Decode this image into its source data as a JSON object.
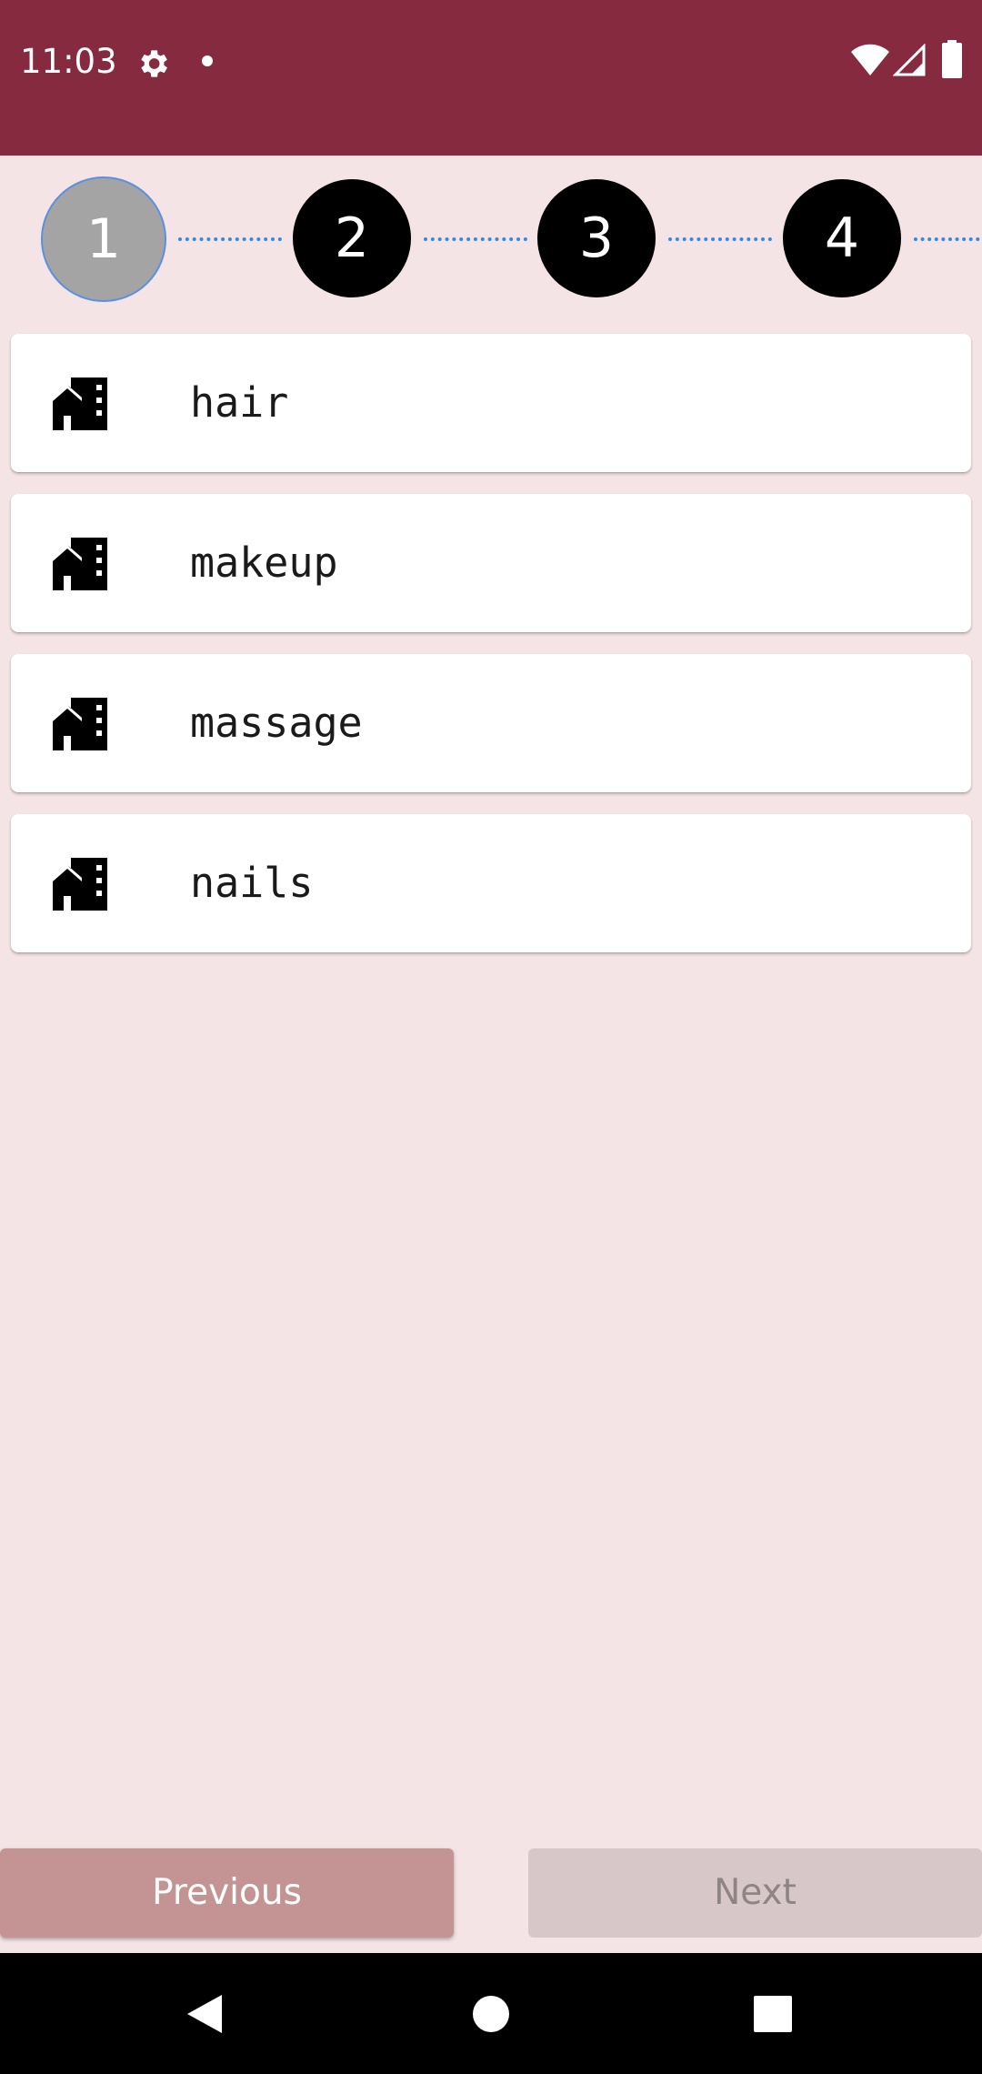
{
  "status_bar": {
    "time": "11:03",
    "bg_color": "#862a40",
    "icons": [
      "gear-icon",
      "dot-icon",
      "wifi-icon",
      "signal-icon",
      "battery-icon"
    ]
  },
  "stepper": {
    "active_step": 1,
    "steps": [
      {
        "label": "1",
        "state": "active"
      },
      {
        "label": "2",
        "state": "inactive"
      },
      {
        "label": "3",
        "state": "inactive"
      },
      {
        "label": "4",
        "state": "inactive"
      }
    ],
    "connector_color": "#2f8be6"
  },
  "services": [
    {
      "label": "hair",
      "icon": "store-building-icon"
    },
    {
      "label": "makeup",
      "icon": "store-building-icon"
    },
    {
      "label": "massage",
      "icon": "store-building-icon"
    },
    {
      "label": "nails",
      "icon": "store-building-icon"
    }
  ],
  "footer": {
    "previous_label": "Previous",
    "next_label": "Next",
    "next_enabled": false
  },
  "nav_bar": {
    "icons": [
      "back-icon",
      "home-icon",
      "recents-icon"
    ]
  },
  "colors": {
    "page_bg": "#f5e4e5",
    "previous_button": "#c49494",
    "next_button_disabled": "#d7c7c8"
  }
}
